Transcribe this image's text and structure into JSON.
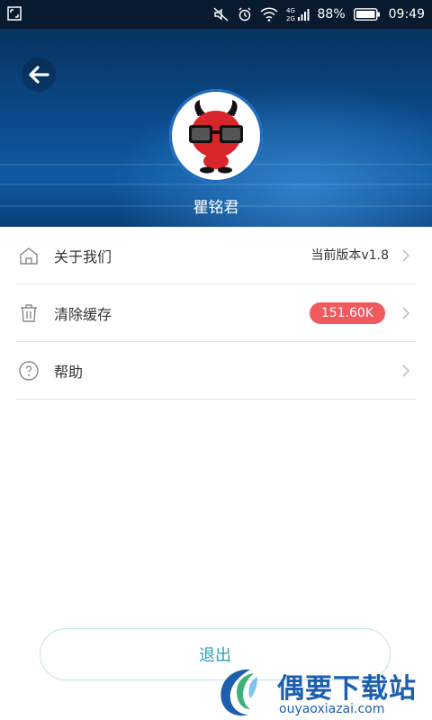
{
  "status_bar": {
    "battery_text": "88%",
    "time": "09:49",
    "network": "4G 2G"
  },
  "header": {
    "username": "瞿铭君"
  },
  "menu": {
    "items": [
      {
        "label": "关于我们",
        "value": "当前版本v1.8",
        "icon": "home-icon"
      },
      {
        "label": "清除缓存",
        "value": "151.60K",
        "icon": "trash-icon"
      },
      {
        "label": "帮助",
        "value": "",
        "icon": "help-icon"
      }
    ]
  },
  "logout_label": "退出",
  "watermark": {
    "title": "偶要下载站",
    "url": "ouyaoxiazai.com"
  },
  "colors": {
    "accent": "#2a9fb6",
    "badge": "#ef5a5e",
    "header_blue": "#0b4a8a"
  }
}
